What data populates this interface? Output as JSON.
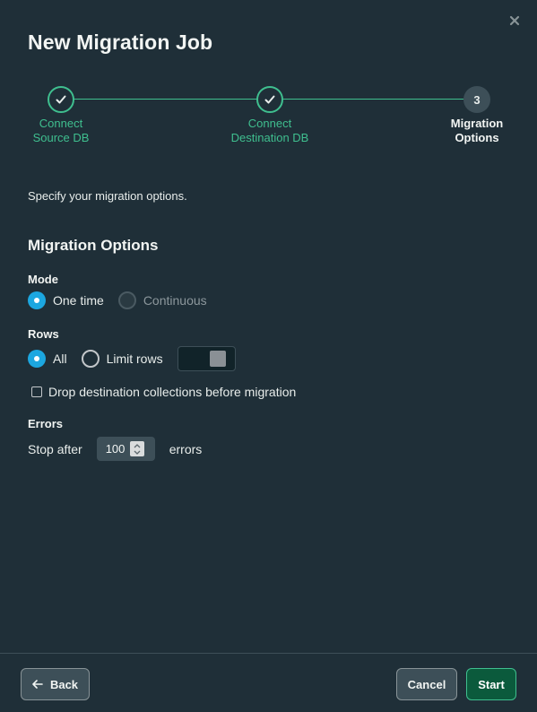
{
  "dialog": {
    "title": "New Migration Job"
  },
  "stepper": {
    "steps": [
      {
        "line1": "Connect",
        "line2": "Source DB",
        "state": "done"
      },
      {
        "line1": "Connect",
        "line2": "Destination DB",
        "state": "done"
      },
      {
        "number": "3",
        "line1": "Migration",
        "line2": "Options",
        "state": "active"
      }
    ]
  },
  "intro": "Specify your migration options.",
  "section_title": "Migration Options",
  "mode": {
    "label": "Mode",
    "options": [
      "One time",
      "Continuous"
    ],
    "selected": "One time"
  },
  "rows": {
    "label": "Rows",
    "options": [
      "All",
      "Limit rows"
    ],
    "selected": "All"
  },
  "drop_option": {
    "label": "Drop destination collections before migration",
    "checked": false
  },
  "errors": {
    "label": "Errors",
    "prefix": "Stop after",
    "value": "100",
    "suffix": "errors"
  },
  "footer": {
    "back_label": "Back",
    "cancel_label": "Cancel",
    "start_label": "Start"
  },
  "colors": {
    "background": "#1f2f38",
    "accent_green": "#3fbf8f",
    "radio_blue": "#1ca7e0",
    "start_button": "#0b5a3c"
  },
  "icons": {
    "close": "close-icon",
    "check": "checkmark-icon",
    "back": "arrow-left-icon",
    "spinner": "chevron-updown-icon"
  }
}
